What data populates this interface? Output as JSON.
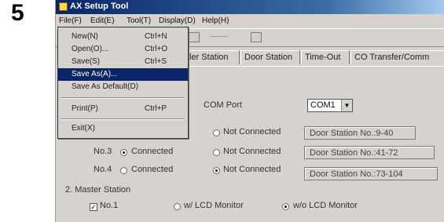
{
  "step_number": "5",
  "window": {
    "title": "AX Setup Tool"
  },
  "menubar": [
    "File(F)",
    "Edit(E)",
    "Tool(T)",
    "Display(D)",
    "Help(H)"
  ],
  "file_menu": {
    "items": [
      {
        "label": "New(N)",
        "shortcut": "Ctrl+N"
      },
      {
        "label": "Open(O)...",
        "shortcut": "Ctrl+O"
      },
      {
        "label": "Save(S)",
        "shortcut": "Ctrl+S"
      },
      {
        "label": "Save As(A)...",
        "shortcut": ""
      },
      {
        "label": "Save As Default(D)",
        "shortcut": ""
      },
      {
        "label": "Print(P)",
        "shortcut": "Ctrl+P"
      },
      {
        "label": "Exit(X)",
        "shortcut": ""
      }
    ],
    "highlighted": "Save As(A)..."
  },
  "tabs": [
    "ler Station",
    "Door Station",
    "Time-Out",
    "CO Transfer/Comm"
  ],
  "com_port": {
    "label": "COM Port",
    "value": "COM1"
  },
  "door_stations": [
    {
      "no": "",
      "connected_label": "",
      "not_connected_label": "Not Connected",
      "selected": "",
      "range": "Door Station No.:9-40"
    },
    {
      "no": "No.3",
      "connected_label": "Connected",
      "not_connected_label": "Not Connected",
      "selected": "connected",
      "range": "Door Station No.:41-72"
    },
    {
      "no": "No.4",
      "connected_label": "Connected",
      "not_connected_label": "Not Connected",
      "selected": "not_connected",
      "range": "Door Station No.:73-104"
    }
  ],
  "master_station": {
    "heading": "2. Master Station",
    "item": "No.1",
    "checked": true,
    "option_lcd": "w/ LCD Monitor",
    "option_no_lcd": "w/o LCD Monitor",
    "selected": "no_lcd"
  }
}
